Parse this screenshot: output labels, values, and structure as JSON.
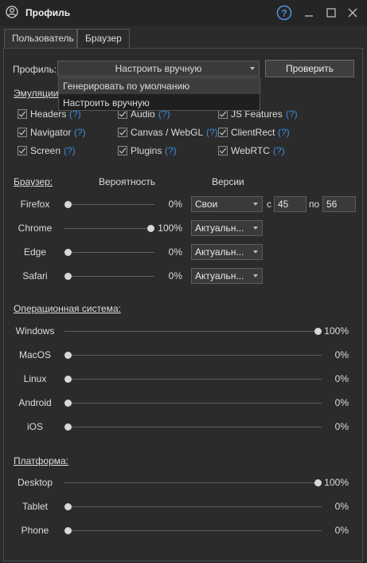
{
  "window": {
    "title": "Профиль"
  },
  "tabs": [
    {
      "label": "Пользователь"
    },
    {
      "label": "Браузер"
    }
  ],
  "profile": {
    "label": "Профиль:",
    "selected": "Настроить вручную",
    "check_button": "Проверить",
    "options": [
      "Генерировать по умолчанию",
      "Настроить вручную"
    ]
  },
  "emulation": {
    "heading": "Эмуляции:",
    "help_mark": "(?)",
    "items": [
      {
        "label": "Headers",
        "checked": true
      },
      {
        "label": "Audio",
        "checked": true
      },
      {
        "label": "JS Features",
        "checked": true
      },
      {
        "label": "Navigator",
        "checked": true
      },
      {
        "label": "Canvas / WebGL",
        "checked": true
      },
      {
        "label": "ClientRect",
        "checked": true
      },
      {
        "label": "Screen",
        "checked": true
      },
      {
        "label": "Plugins",
        "checked": true
      },
      {
        "label": "WebRTC",
        "checked": true
      }
    ]
  },
  "browser": {
    "heading": "Браузер:",
    "col_probability": "Вероятность",
    "col_versions": "Версии",
    "rows": [
      {
        "name": "Firefox",
        "probability": 0,
        "pct": "0%",
        "version": "Свои",
        "from_label": "с",
        "from": "45",
        "to_label": "по",
        "to": "56"
      },
      {
        "name": "Chrome",
        "probability": 100,
        "pct": "100%",
        "version": "Актуальн..."
      },
      {
        "name": "Edge",
        "probability": 0,
        "pct": "0%",
        "version": "Актуальн..."
      },
      {
        "name": "Safari",
        "probability": 0,
        "pct": "0%",
        "version": "Актуальн..."
      }
    ]
  },
  "os": {
    "heading": "Операционная система:",
    "rows": [
      {
        "name": "Windows",
        "probability": 100,
        "pct": "100%"
      },
      {
        "name": "MacOS",
        "probability": 0,
        "pct": "0%"
      },
      {
        "name": "Linux",
        "probability": 0,
        "pct": "0%"
      },
      {
        "name": "Android",
        "probability": 0,
        "pct": "0%"
      },
      {
        "name": "iOS",
        "probability": 0,
        "pct": "0%"
      }
    ]
  },
  "platform": {
    "heading": "Платформа:",
    "rows": [
      {
        "name": "Desktop",
        "probability": 100,
        "pct": "100%"
      },
      {
        "name": "Tablet",
        "probability": 0,
        "pct": "0%"
      },
      {
        "name": "Phone",
        "probability": 0,
        "pct": "0%"
      }
    ]
  },
  "colors": {
    "accent": "#3d8be0",
    "background": "#2b2b2b",
    "titlebar": "#252525"
  }
}
